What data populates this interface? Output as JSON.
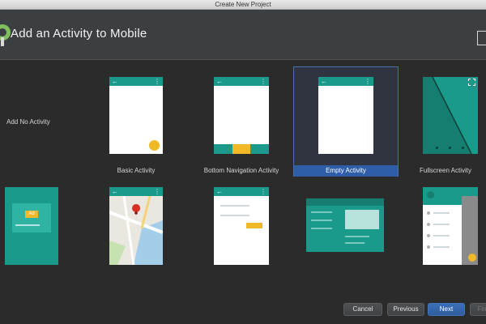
{
  "window": {
    "title": "Create New Project"
  },
  "header": {
    "title": "Add an Activity to Mobile"
  },
  "gallery": {
    "no_activity_label": "Add No Activity",
    "row1": [
      {
        "label": "Basic Activity"
      },
      {
        "label": "Bottom Navigation Activity"
      },
      {
        "label": "Empty Activity",
        "selected": true
      },
      {
        "label": "Fullscreen Activity"
      }
    ],
    "ad_chip": "Ad"
  },
  "footer": {
    "cancel": "Cancel",
    "previous": "Previous",
    "next": "Next",
    "finish": "Finish"
  },
  "colors": {
    "primary_teal": "#1a9a8a",
    "accent_yellow": "#f1b928",
    "selection_blue": "#2f5ea8"
  }
}
